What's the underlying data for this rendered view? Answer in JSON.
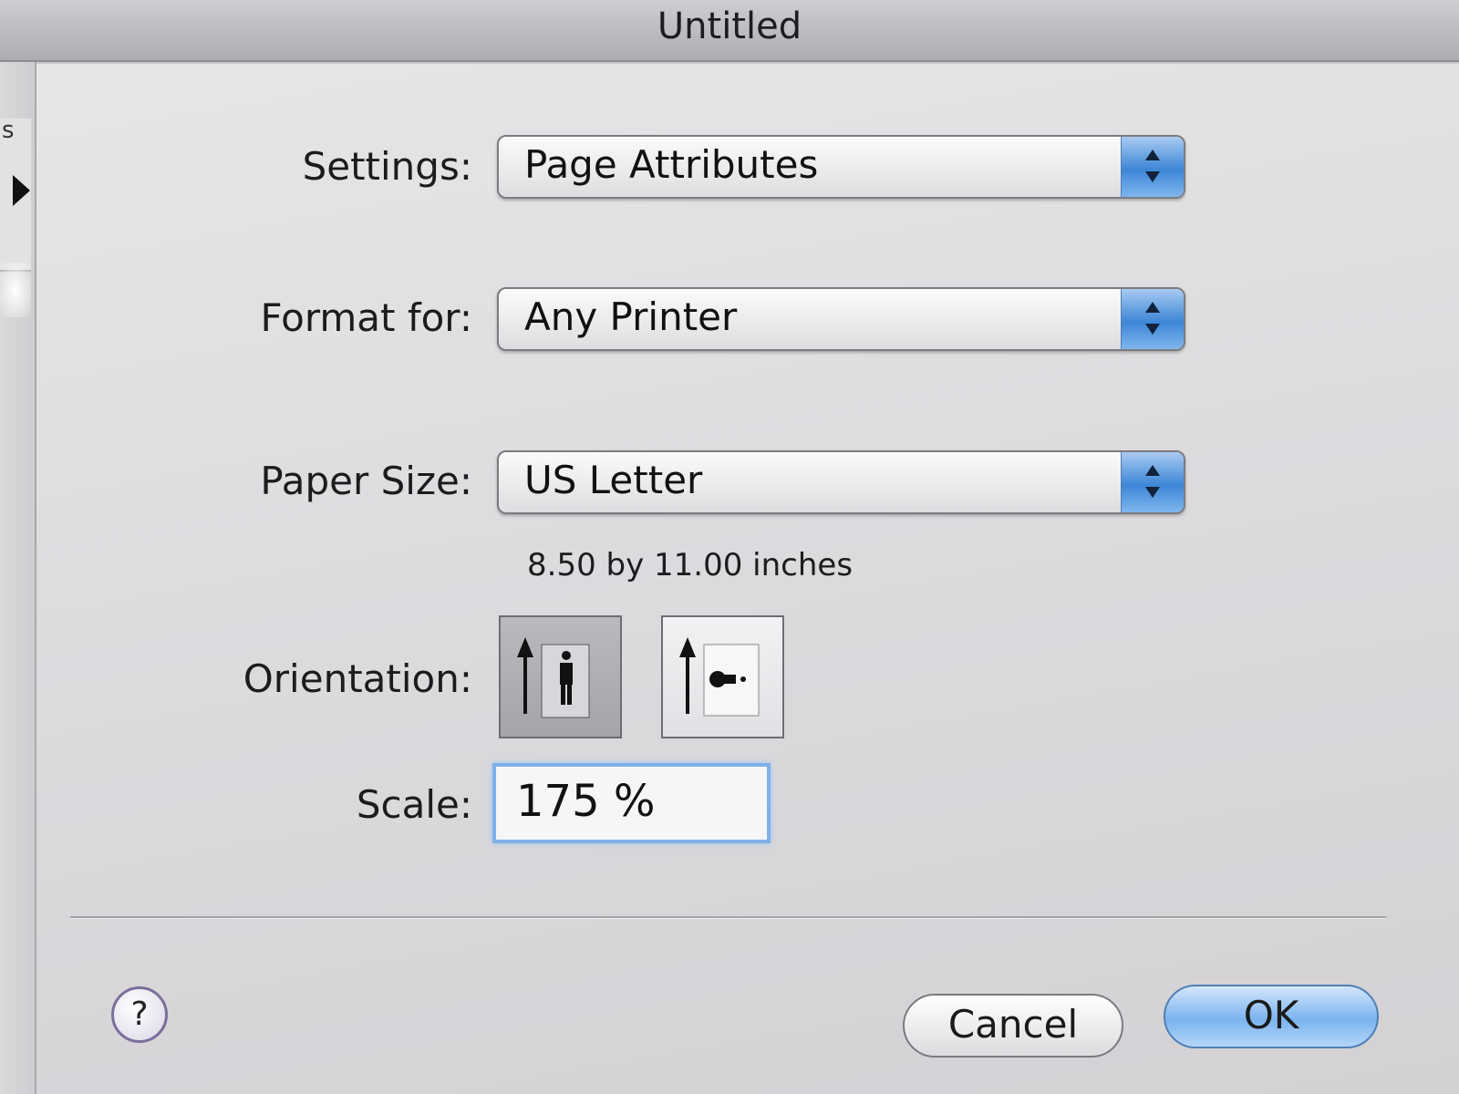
{
  "window": {
    "title": "Untitled"
  },
  "left_strip": {
    "letter": "s"
  },
  "settings": {
    "label": "Settings:",
    "value": "Page Attributes"
  },
  "format_for": {
    "label": "Format for:",
    "value": "Any Printer"
  },
  "paper_size": {
    "label": "Paper Size:",
    "value": "US Letter",
    "dimensions": "8.50 by 11.00 inches"
  },
  "orientation": {
    "label": "Orientation:",
    "options": [
      "portrait",
      "landscape"
    ],
    "selected": "portrait"
  },
  "scale": {
    "label": "Scale:",
    "value": "175 %"
  },
  "buttons": {
    "help": "?",
    "cancel": "Cancel",
    "ok": "OK"
  },
  "colors": {
    "accent_blue": "#3d86d6",
    "focus_ring": "#7fb1e8"
  },
  "icons": {
    "popup_arrows": "up-down-chevron-icon",
    "portrait": "portrait-orientation-icon",
    "landscape": "landscape-orientation-icon",
    "help": "question-mark-icon"
  }
}
